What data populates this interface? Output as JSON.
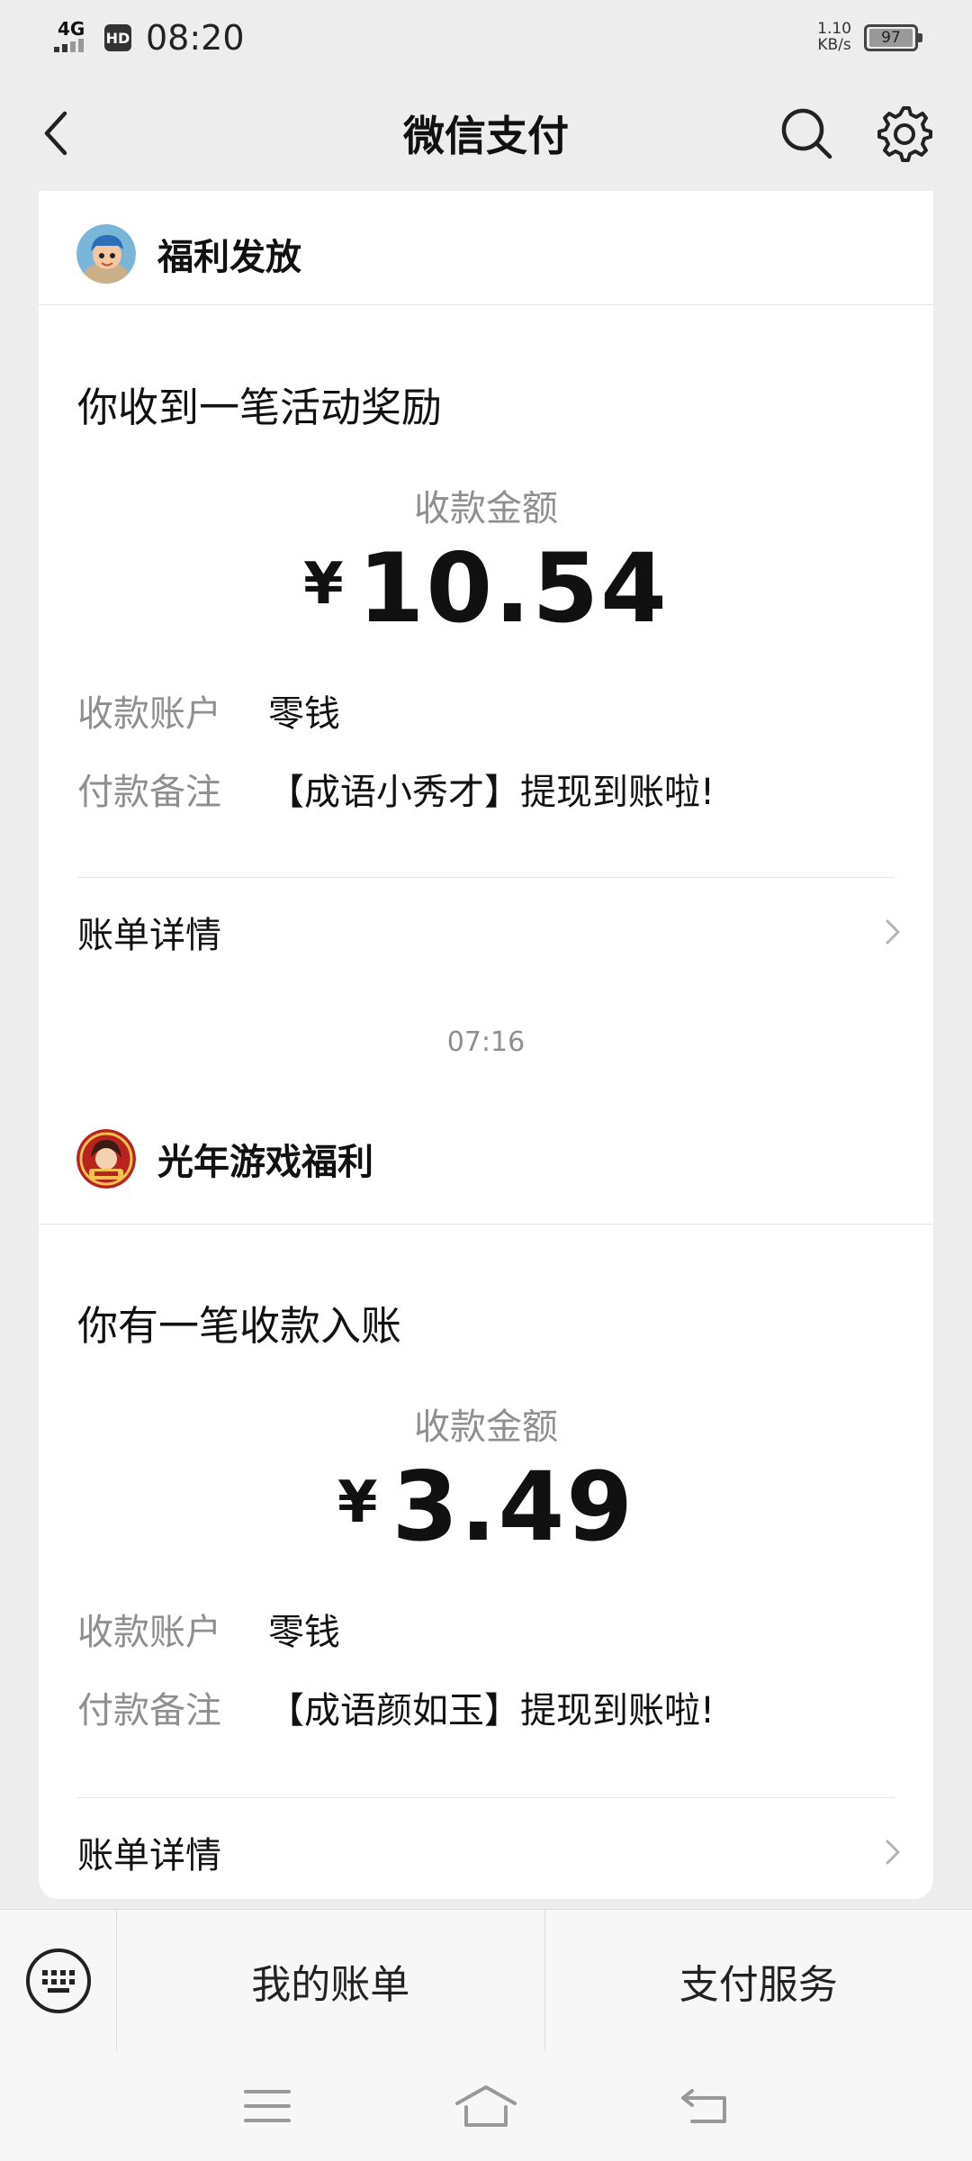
{
  "status_bar": {
    "network": "4G",
    "hd_badge": "HD",
    "time": "08:20",
    "speed_value": "1.10",
    "speed_unit": "KB/s",
    "battery": "97"
  },
  "nav": {
    "title": "微信支付",
    "back_icon": "chevron-left-icon",
    "search_icon": "search-icon",
    "settings_icon": "gear-icon"
  },
  "messages": [
    {
      "sender": "福利发放",
      "title": "你收到一笔活动奖励",
      "amount_label": "收款金额",
      "currency": "¥",
      "amount": "10.54",
      "account_key": "收款账户",
      "account_value": "零钱",
      "note_key": "付款备注",
      "note_value": "【成语小秀才】提现到账啦!",
      "detail_link": "账单详情"
    },
    {
      "timestamp": "07:16",
      "sender": "光年游戏福利",
      "title": "你有一笔收款入账",
      "amount_label": "收款金额",
      "currency": "¥",
      "amount": "3.49",
      "account_key": "收款账户",
      "account_value": "零钱",
      "note_key": "付款备注",
      "note_value": "【成语颜如玉】提现到账啦!",
      "detail_link": "账单详情"
    }
  ],
  "bottom_menu": {
    "keyboard_icon": "keyboard-icon",
    "item1": "我的账单",
    "item2": "支付服务"
  },
  "system_nav": {
    "menu_icon": "menu-icon",
    "home_icon": "home-icon",
    "back_icon": "back-icon"
  }
}
